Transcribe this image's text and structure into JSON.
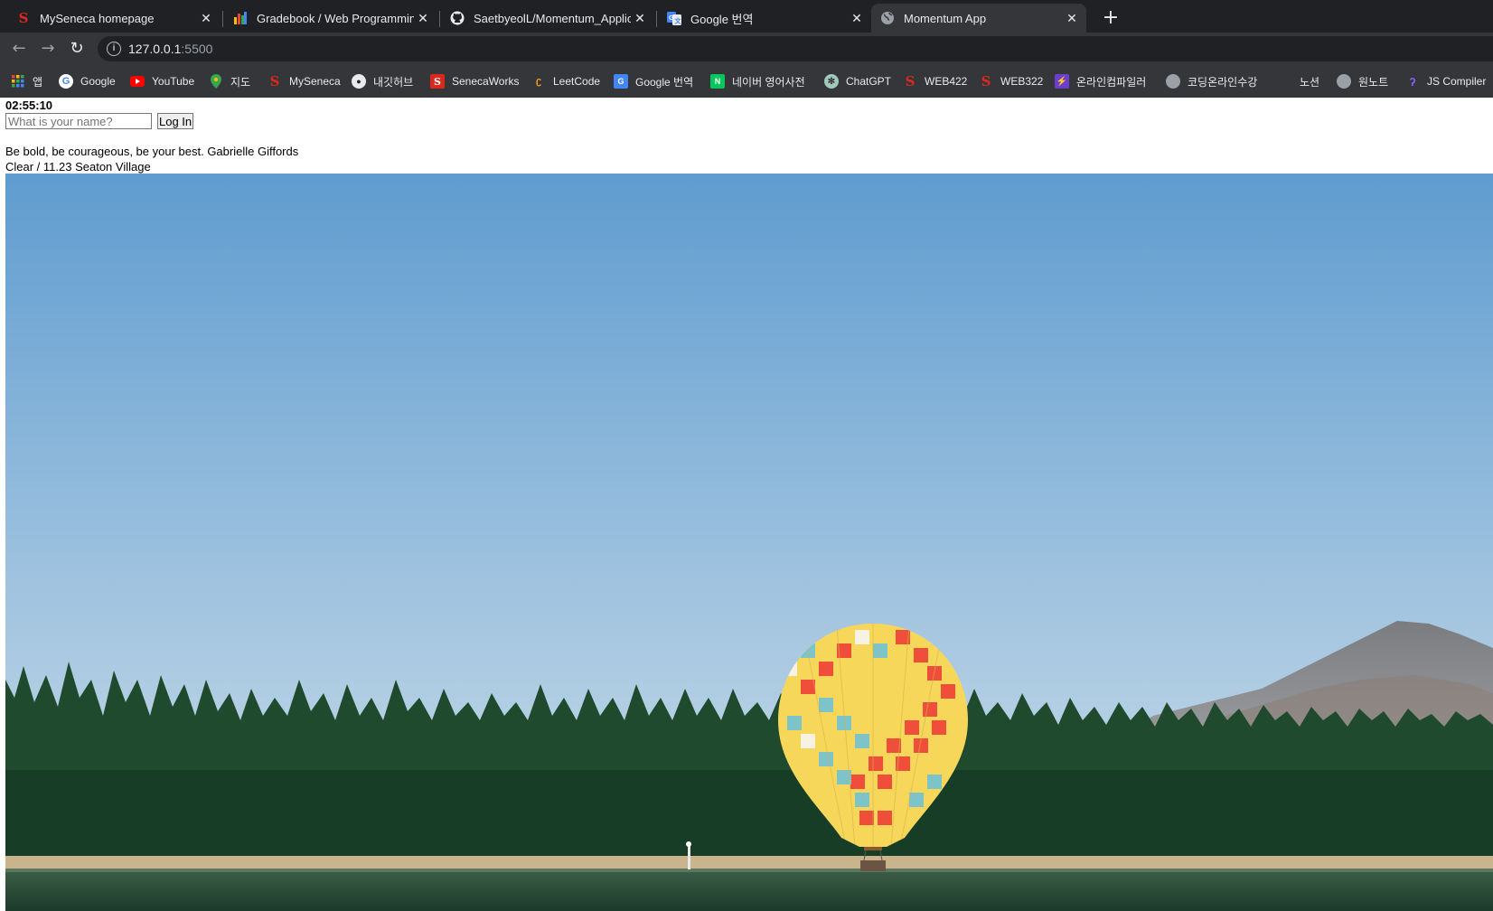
{
  "tabs": [
    {
      "title": "MySeneca homepage",
      "favicon": "seneca-s-icon",
      "close": "✕"
    },
    {
      "title": "Gradebook / Web Programming",
      "favicon": "gradebook-chart-icon",
      "close": "✕"
    },
    {
      "title": "SaetbyeolL/Momentum_Application",
      "favicon": "github-icon",
      "close": "✕"
    },
    {
      "title": "Google 번역",
      "favicon": "google-translate-icon",
      "close": "✕"
    },
    {
      "title": "Momentum App",
      "favicon": "globe-icon",
      "close": "✕"
    }
  ],
  "new_tab_label": "+",
  "nav": {
    "back": "←",
    "forward": "→",
    "reload": "↻"
  },
  "address": {
    "host": "127.0.0.1",
    "port": ":5500",
    "info": "i"
  },
  "bookmarks": [
    {
      "label": "앱",
      "icon": "apps-grid-icon"
    },
    {
      "label": "Google",
      "icon": "google-icon"
    },
    {
      "label": "YouTube",
      "icon": "youtube-icon"
    },
    {
      "label": "지도",
      "icon": "maps-pin-icon"
    },
    {
      "label": "MySeneca",
      "icon": "seneca-s-icon"
    },
    {
      "label": "내깃허브",
      "icon": "github-icon"
    },
    {
      "label": "SenecaWorks",
      "icon": "senecaworks-icon"
    },
    {
      "label": "LeetCode",
      "icon": "leetcode-icon"
    },
    {
      "label": "Google 번역",
      "icon": "google-translate-icon"
    },
    {
      "label": "네이버 영어사전",
      "icon": "naver-dict-icon"
    },
    {
      "label": "ChatGPT",
      "icon": "chatgpt-icon"
    },
    {
      "label": "WEB422",
      "icon": "seneca-s-icon"
    },
    {
      "label": "WEB322",
      "icon": "seneca-s-icon"
    },
    {
      "label": "온라인컴파일러",
      "icon": "lightning-icon"
    },
    {
      "label": "코딩온라인수강",
      "icon": "globe-icon"
    },
    {
      "label": "노션",
      "icon": "notion-icon"
    },
    {
      "label": "원노트",
      "icon": "globe-icon"
    },
    {
      "label": "JS Compiler",
      "icon": "js-compiler-icon"
    }
  ],
  "page": {
    "clock": "02:55:10",
    "login_placeholder": "What is your name?",
    "login_button": "Log In",
    "quote": "Be bold, be courageous, be your best. Gabrielle Giffords",
    "weather": "Clear / 11.23 Seaton Village"
  },
  "colors": {
    "tabstrip": "#202124",
    "toolbar": "#35363a",
    "seneca_red": "#da291c",
    "sky_top": "#5f9ccf",
    "sky_bottom": "#c7dbe8",
    "forest": "#1f4a2e"
  }
}
